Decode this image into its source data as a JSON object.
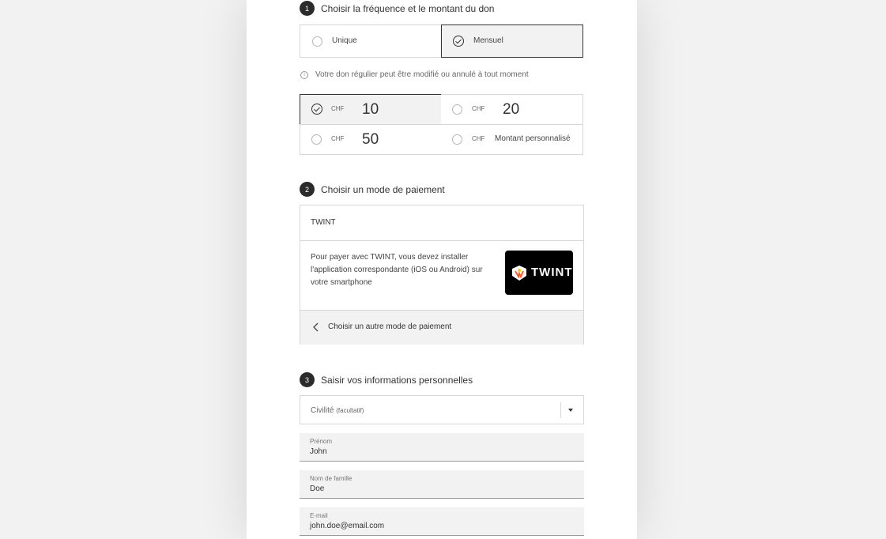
{
  "step1": {
    "number": "1",
    "title": "Choisir la fréquence et le montant du don",
    "frequency": [
      {
        "label": "Unique",
        "selected": false
      },
      {
        "label": "Mensuel",
        "selected": true
      }
    ],
    "note": "Votre don régulier peut être modifié ou annulé à tout moment",
    "currency": "CHF",
    "amounts": [
      {
        "value": "10",
        "selected": true
      },
      {
        "value": "20",
        "selected": false
      },
      {
        "value": "50",
        "selected": false
      },
      {
        "value": "Montant personnalisé",
        "selected": false
      }
    ]
  },
  "step2": {
    "number": "2",
    "title": "Choisir un mode de paiement",
    "method_name": "TWINT",
    "description": "Pour payer avec TWINT, vous devez installer l'application correspondante (iOS ou Android) sur votre smartphone",
    "logo_text": "TWINT",
    "back_label": "Choisir un autre mode de paiement"
  },
  "step3": {
    "number": "3",
    "title": "Saisir vos informations personnelles",
    "civility_label": "Civilité",
    "civility_optional": "(facultatif)",
    "fields": [
      {
        "label": "Prénom",
        "value": "John"
      },
      {
        "label": "Nom de famille",
        "value": "Doe"
      },
      {
        "label": "E-mail",
        "value": "john.doe@email.com"
      }
    ]
  },
  "colors": {
    "background": "#f2f2f2",
    "panel": "#ffffff",
    "selected_bg": "#f2f2f2",
    "dark": "#2b2b2b",
    "twint_logo_bg": "#000000"
  }
}
